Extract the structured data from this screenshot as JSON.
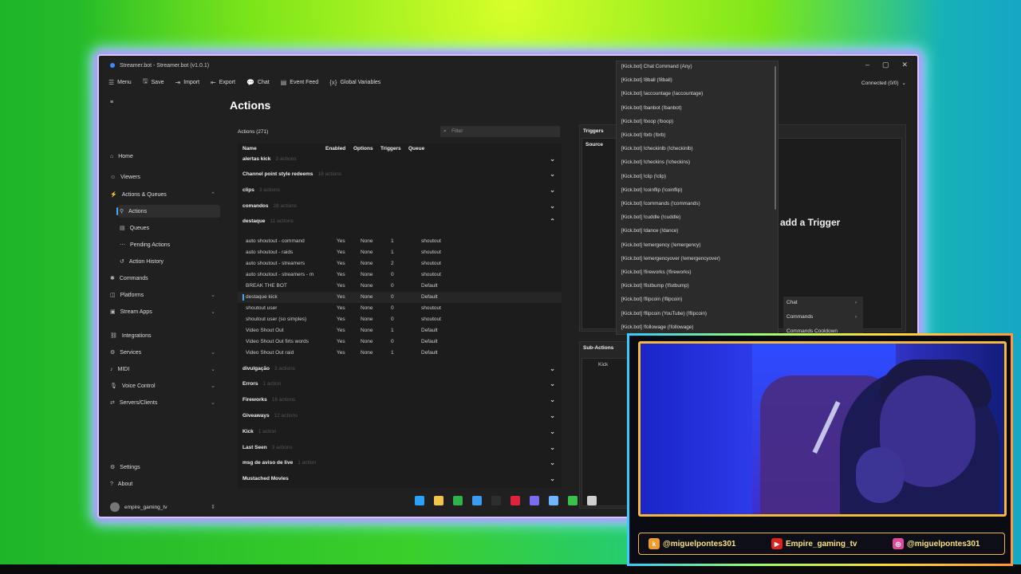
{
  "window": {
    "title": "Streamer.bot - Streamer.bot (v1.0.1)",
    "connection": "Connected (0/0)"
  },
  "toolbar": [
    {
      "label": "Menu",
      "icon": "menu-icon"
    },
    {
      "label": "Save",
      "icon": "save-icon"
    },
    {
      "label": "Import",
      "icon": "import-icon"
    },
    {
      "label": "Export",
      "icon": "export-icon"
    },
    {
      "label": "Chat",
      "icon": "chat-icon"
    },
    {
      "label": "Event Feed",
      "icon": "event-feed-icon"
    },
    {
      "label": "Global Variables",
      "icon": "variables-icon"
    }
  ],
  "sidebar": {
    "items": [
      {
        "label": "Home",
        "icon": "home-icon",
        "expandable": false
      },
      {
        "label": "Viewers",
        "icon": "viewers-icon",
        "expandable": false
      },
      {
        "label": "Actions & Queues",
        "icon": "actions-icon",
        "expandable": true,
        "expanded": true
      },
      {
        "label": "Actions",
        "icon": "action-icon",
        "sub": true,
        "active": true
      },
      {
        "label": "Queues",
        "icon": "queues-icon",
        "sub": true
      },
      {
        "label": "Pending Actions",
        "icon": "pending-icon",
        "sub": true
      },
      {
        "label": "Action History",
        "icon": "history-icon",
        "sub": true
      },
      {
        "label": "Commands",
        "icon": "commands-icon",
        "expandable": false
      },
      {
        "label": "Platforms",
        "icon": "platforms-icon",
        "expandable": true
      },
      {
        "label": "Stream Apps",
        "icon": "stream-apps-icon",
        "expandable": true
      },
      {
        "label": "Integrations",
        "icon": "integrations-icon",
        "expandable": false
      },
      {
        "label": "Services",
        "icon": "services-icon",
        "expandable": true
      },
      {
        "label": "MIDI",
        "icon": "midi-icon",
        "expandable": true
      },
      {
        "label": "Voice Control",
        "icon": "voice-icon",
        "expandable": true
      },
      {
        "label": "Servers/Clients",
        "icon": "servers-icon",
        "expandable": true
      }
    ],
    "bottom": [
      {
        "label": "Settings",
        "icon": "settings-icon"
      },
      {
        "label": "About",
        "icon": "about-icon"
      }
    ],
    "user": "empire_gaming_tv"
  },
  "main": {
    "title": "Actions",
    "actions_count": "Actions (271)",
    "filter_placeholder": "Filter",
    "columns": [
      "Name",
      "Enabled",
      "Options",
      "Triggers",
      "Queue"
    ],
    "groups_top": [
      {
        "name": "alertas kick",
        "count": "3 actions"
      },
      {
        "name": "Channel point style redeems",
        "count": "18 actions"
      },
      {
        "name": "clips",
        "count": "3 actions"
      },
      {
        "name": "comandos",
        "count": "28 actions"
      },
      {
        "name": "destaque",
        "count": "11 actions"
      }
    ],
    "rows": [
      {
        "name": "auto shoutout - command",
        "enabled": "Yes",
        "options": "None",
        "triggers": "1",
        "queue": "shoutout"
      },
      {
        "name": "auto shoutout - raids",
        "enabled": "Yes",
        "options": "None",
        "triggers": "1",
        "queue": "shoutout"
      },
      {
        "name": "auto shoutout - streamers",
        "enabled": "Yes",
        "options": "None",
        "triggers": "2",
        "queue": "shoutout"
      },
      {
        "name": "auto shoutout - streamers - m",
        "enabled": "Yes",
        "options": "None",
        "triggers": "0",
        "queue": "shoutout"
      },
      {
        "name": "BREAK THE BOT",
        "enabled": "Yes",
        "options": "None",
        "triggers": "0",
        "queue": "Default"
      },
      {
        "name": "destaque kick",
        "enabled": "Yes",
        "options": "None",
        "triggers": "0",
        "queue": "Default"
      },
      {
        "name": "shoutout user",
        "enabled": "Yes",
        "options": "None",
        "triggers": "0",
        "queue": "shoutout"
      },
      {
        "name": "shoutout user (so simples)",
        "enabled": "Yes",
        "options": "None",
        "triggers": "0",
        "queue": "shoutout"
      },
      {
        "name": "Video Shout Out",
        "enabled": "Yes",
        "options": "None",
        "triggers": "1",
        "queue": "Default"
      },
      {
        "name": "Video Shout Out firts words",
        "enabled": "Yes",
        "options": "None",
        "triggers": "0",
        "queue": "Default"
      },
      {
        "name": "Video Shout Out raid",
        "enabled": "Yes",
        "options": "None",
        "triggers": "1",
        "queue": "Default"
      }
    ],
    "groups_bottom": [
      {
        "name": "divulgação",
        "count": "3 actions"
      },
      {
        "name": "Errors",
        "count": "1 action"
      },
      {
        "name": "Fireworks",
        "count": "16 actions"
      },
      {
        "name": "Giveaways",
        "count": "12 actions"
      },
      {
        "name": "Kick",
        "count": "1 action"
      },
      {
        "name": "Last Seen",
        "count": "3 actions"
      },
      {
        "name": "msg de aviso de live",
        "count": "1 action"
      },
      {
        "name": "Mustached Movies",
        "count": ""
      }
    ]
  },
  "triggers": {
    "title": "Triggers",
    "source_col": "Source",
    "add_trigger": "add a Trigger"
  },
  "subactions": {
    "title": "Sub-Actions",
    "first_stub": "Kick"
  },
  "dropdown": {
    "items": [
      "[Kick.bot] Chat Command (Any)",
      "[Kick.bot] !8ball (!8ball)",
      "[Kick.bot] !accountage (!accountage)",
      "[Kick.bot] !banbot (!banbot)",
      "[Kick.bot] !boop (!boop)",
      "[Kick.bot] !brb (!brb)",
      "[Kick.bot] !checkinlb (!checkinlb)",
      "[Kick.bot] !checkins (!checkins)",
      "[Kick.bot] !clip (!clip)",
      "[Kick.bot] !coinflip (!coinflip)",
      "[Kick.bot] !commands (!commands)",
      "[Kick.bot] !cuddle (!cuddle)",
      "[Kick.bot] !dance (!dance)",
      "[Kick.bot] !emergency (!emergency)",
      "[Kick.bot] !emergencyover (!emergencyover)",
      "[Kick.bot] !fireworks (!fireworks)",
      "[Kick.bot] !fistbump (!fistbump)",
      "[Kick.bot] !flipcoin (!flipcoin)",
      "[Kick.bot] !flipcoin (YouTube) (!flipcoin)",
      "[Kick.bot] !followage (!followage)"
    ],
    "stub_label": "[Kic"
  },
  "context_menu": [
    {
      "label": "Chat"
    },
    {
      "label": "Commands"
    },
    {
      "label": "Commands Cooldown"
    }
  ],
  "taskbar": [
    {
      "icon": "windows-icon",
      "color": "#2aa3ff"
    },
    {
      "icon": "explorer-icon",
      "color": "#f2c34a"
    },
    {
      "icon": "xbox-icon",
      "color": "#2fb34a"
    },
    {
      "icon": "store-icon",
      "color": "#3a9cf0"
    },
    {
      "icon": "terminal-icon",
      "color": "#2e2e2e"
    },
    {
      "icon": "opera-icon",
      "color": "#e0223b"
    },
    {
      "icon": "discord-icon",
      "color": "#7a6cf0"
    },
    {
      "icon": "streamerbot-icon",
      "color": "#6fb4ff"
    },
    {
      "icon": "play-icon",
      "color": "#39c24a"
    },
    {
      "icon": "obs-icon",
      "color": "#d0d0d0"
    }
  ],
  "socials": [
    {
      "icon": "kick-icon",
      "handle": "@miguelpontes301",
      "color": "#f29a2a"
    },
    {
      "icon": "youtube-icon",
      "handle": "Empire_gaming_tv",
      "color": "#e0221b"
    },
    {
      "icon": "instagram-icon",
      "handle": "@miguelpontes301",
      "color": "#e04a9a"
    }
  ]
}
